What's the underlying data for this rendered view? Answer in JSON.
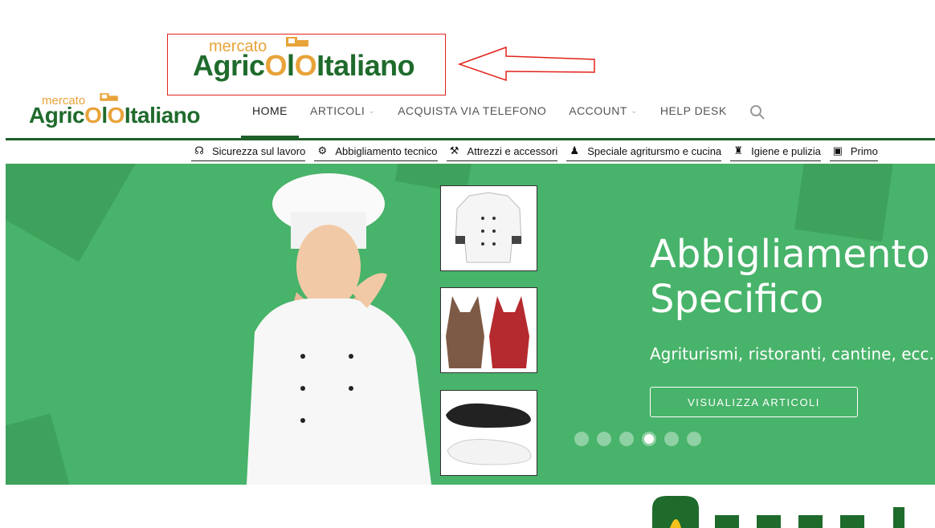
{
  "logo": {
    "mercato": "mercato",
    "agricolo": "Agric",
    "italiano": "Italiano"
  },
  "nav": {
    "items": [
      {
        "label": "HOME",
        "active": true,
        "dropdown": false
      },
      {
        "label": "ARTICOLI",
        "active": false,
        "dropdown": true
      },
      {
        "label": "ACQUISTA VIA TELEFONO",
        "active": false,
        "dropdown": false
      },
      {
        "label": "ACCOUNT",
        "active": false,
        "dropdown": true
      },
      {
        "label": "HELP DESK",
        "active": false,
        "dropdown": false
      }
    ],
    "search_icon": "search-icon"
  },
  "categories": [
    {
      "label": "Sicurezza sul lavoro",
      "icon": "headset-icon"
    },
    {
      "label": "Abbigliamento tecnico",
      "icon": "users-gear-icon"
    },
    {
      "label": "Attrezzi e accessori",
      "icon": "wrench-icon"
    },
    {
      "label": "Speciale agritursmo e cucina",
      "icon": "person-pin-icon"
    },
    {
      "label": "Igiene e pulizia",
      "icon": "worker-icon"
    },
    {
      "label": "Primo",
      "icon": "first-aid-icon"
    }
  ],
  "hero": {
    "title_line1": "Abbigliamento",
    "title_line2": "Specifico",
    "subtitle": "Agriturismi, ristoranti, cantine, ecc...",
    "button_label": "VISUALIZZA ARTICOLI",
    "slide_count": 6,
    "active_slide": 4
  },
  "colors": {
    "brand_green": "#1f6b2c",
    "hero_green": "#48b36a",
    "accent_orange": "#e8a33a",
    "callout_red": "#e2231a"
  }
}
